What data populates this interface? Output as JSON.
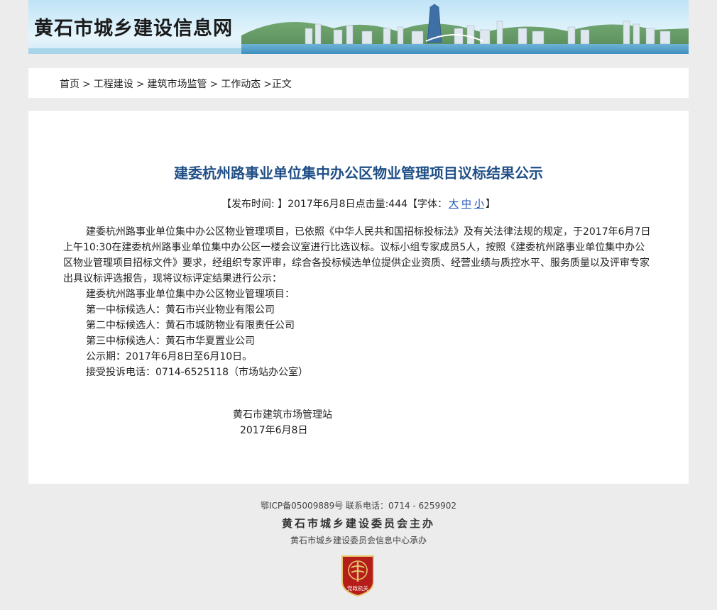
{
  "header": {
    "site_title": "黄石市城乡建设信息网"
  },
  "breadcrumb": {
    "items": [
      "首页",
      "工程建设",
      "建筑市场监管",
      "工作动态"
    ],
    "separator": ">",
    "current": "正文"
  },
  "article": {
    "title": "建委杭州路事业单位集中办公区物业管理项目议标结果公示",
    "meta": {
      "publish_prefix": "【发布时间: 】2017年6月8日",
      "clicks_label": "点击量:",
      "clicks": "444",
      "font_label": "【字体：",
      "font_large": "大",
      "font_medium": "中",
      "font_small": "小",
      "font_close": "】"
    },
    "paragraph_1": "建委杭州路事业单位集中办公区物业管理项目，已依照《中华人民共和国招标投标法》及有关法律法规的规定，于2017年6月7日上午10:30在建委杭州路事业单位集中办公区一楼会议室进行比选议标。议标小组专家成员5人，按照《建委杭州路事业单位集中办公区物业管理项目招标文件》要求，经组织专家评审，综合各投标候选单位提供企业资质、经营业绩与质控水平、服务质量以及评审专家出具议标评选报告，现将议标评定结果进行公示：",
    "lines": [
      "建委杭州路事业单位集中办公区物业管理项目：",
      "第一中标候选人：黄石市兴业物业有限公司",
      "第二中标候选人：黄石市城防物业有限责任公司",
      "第三中标候选人：黄石市华夏置业公司",
      "公示期：2017年6月8日至6月10日。",
      "接受投诉电话：0714-6525118（市场站办公室）"
    ],
    "signature_org": "黄石市建筑市场管理站",
    "signature_date": "2017年6月8日"
  },
  "footer": {
    "icp_line": "鄂ICP备05009889号 联系电话：0714 - 6259902",
    "host": "黄石市城乡建设委员会主办",
    "undertaker": "黄石市城乡建设委员会信息中心承办",
    "emblem_text": "党政机关"
  },
  "colors": {
    "title_blue": "#1f4f86",
    "link_blue": "#1a4fb4",
    "emblem_red": "#b51d1a",
    "emblem_gold": "#e7c46a"
  }
}
